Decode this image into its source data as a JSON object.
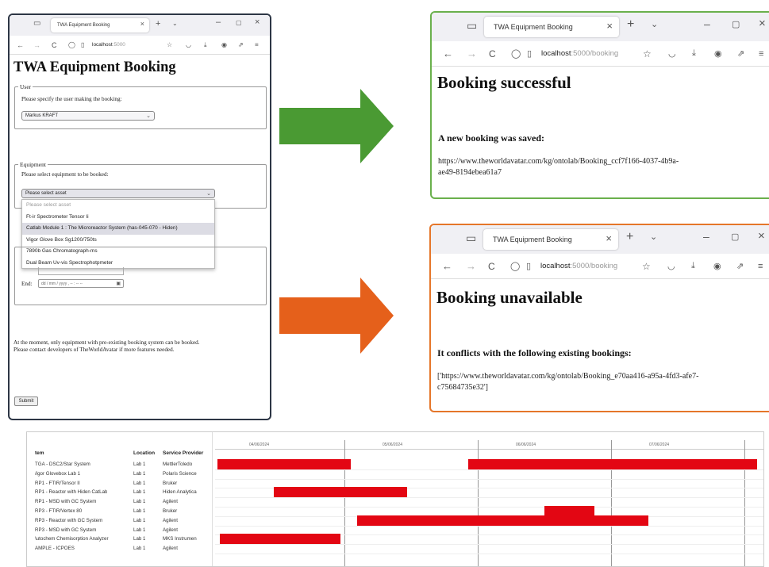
{
  "form_window": {
    "tab_title": "TWA Equipment Booking",
    "url_host": "localhost",
    "url_port": ":5000",
    "heading": "TWA Equipment Booking",
    "user_legend": "User",
    "user_prompt": "Please specify the user making the booking:",
    "user_selected": "Markus KRAFT",
    "equipment_legend": "Equipment",
    "equipment_prompt": "Please select equipment to be booked:",
    "equipment_selected": "Please select asset",
    "equipment_options": [
      "Please select asset",
      "Ft-ir Spectrometer Tensor Ii",
      "Catlab Module 1 : The Microreactor System (has-045-070 - Hiden)",
      "Vigor Glove Box Sg1200/750ts",
      "7890b Gas Chromatograph-ms",
      "Dual Beam Uv-vis Spectrophotpmeter"
    ],
    "end_label": "End:",
    "end_placeholder": "dd / mm / yyyy ,  -- : -- --",
    "note_line1": "At the moment, only equipment with pre-existing booking system can be booked.",
    "note_line2": "Please contact developers of TheWorldAvatar if more features needed.",
    "submit_label": "Submit"
  },
  "success_window": {
    "tab_title": "TWA Equipment Booking",
    "url_host": "localhost",
    "url_path": ":5000/booking",
    "heading": "Booking successful",
    "subheading": "A new booking was saved:",
    "iri_line1": "https://www.theworldavatar.com/kg/ontolab/Booking_ccf7f166-4037-4b9a-",
    "iri_line2": "ae49-8194ebea61a7"
  },
  "fail_window": {
    "tab_title": "TWA Equipment Booking",
    "url_host": "localhost",
    "url_path": ":5000/booking",
    "heading": "Booking unavailable",
    "subheading": "It conflicts with the following existing bookings:",
    "iri_line1": "['https://www.theworldavatar.com/kg/ontolab/Booking_e70aa416-a95a-4fd3-afe7-",
    "iri_line2": "c75684735e32']"
  },
  "colors": {
    "success_border": "#6ab04c",
    "fail_border": "#e5762a",
    "form_border": "#2d3645",
    "green_arrow": "#4a9a33",
    "orange_arrow": "#e5601b",
    "gantt_bar": "#e30613"
  },
  "gantt": {
    "headers": {
      "item": "tem",
      "location": "Location",
      "provider": "Service Provider"
    },
    "dates": [
      "04/06/2024",
      "05/06/2024",
      "06/06/2024",
      "07/06/2024"
    ],
    "rows": [
      {
        "item": "TGA - DSC2/Star System",
        "location": "Lab 1",
        "provider": "MettlerToledo",
        "bookings": [
          [
            0.0,
            1.0
          ],
          [
            1.88,
            4.05
          ]
        ]
      },
      {
        "item": "/igor Glovebox Lab 1",
        "location": "Lab 1",
        "provider": "Polaris Science",
        "bookings": []
      },
      {
        "item": "RP1 - FTIR/Tensor II",
        "location": "Lab 1",
        "provider": "Bruker",
        "bookings": []
      },
      {
        "item": "RP1 - Reactor with Hiden CatLab",
        "location": "Lab 1",
        "provider": "Hiden Analytica",
        "bookings": [
          [
            0.42,
            1.42
          ]
        ]
      },
      {
        "item": "RP1 - MSD with GC System",
        "location": "Lab 1",
        "provider": "Agilent",
        "bookings": []
      },
      {
        "item": "RP3 - FTIR/Vertex 80",
        "location": "Lab 1",
        "provider": "Bruker",
        "bookings": [
          [
            2.45,
            2.83
          ]
        ]
      },
      {
        "item": "RP3 - Reactor with GC System",
        "location": "Lab 1",
        "provider": "Agilent",
        "bookings": [
          [
            1.05,
            3.23
          ]
        ]
      },
      {
        "item": "RP3 - MSD with GC System",
        "location": "Lab 1",
        "provider": "Agilent",
        "bookings": []
      },
      {
        "item": "\\utochem Chemisorption Analyzer",
        "location": "Lab 1",
        "provider": "MKS Instrumen",
        "bookings": [
          [
            0.02,
            0.92
          ]
        ]
      },
      {
        "item": "AMPLE - ICPOES",
        "location": "Lab 1",
        "provider": "Agilent",
        "bookings": []
      }
    ]
  }
}
